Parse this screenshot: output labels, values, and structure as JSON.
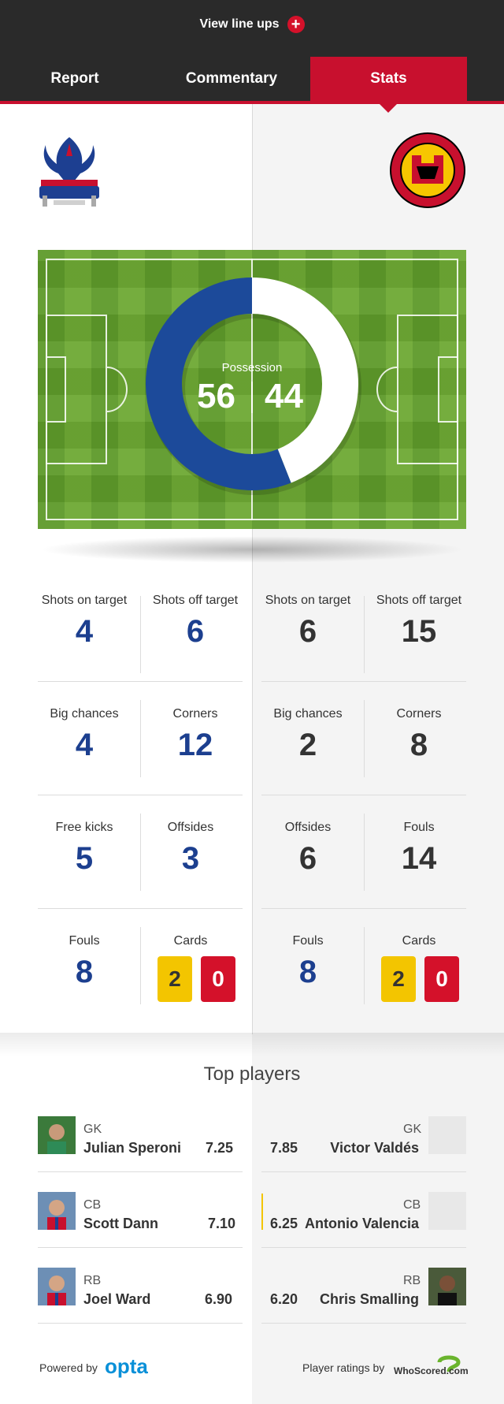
{
  "header": {
    "lineups_label": "View line ups",
    "plus_icon": "+"
  },
  "tabs": [
    {
      "label": "Report"
    },
    {
      "label": "Commentary"
    },
    {
      "label": "Stats",
      "active": true
    }
  ],
  "teams": {
    "home": {
      "crest": "Crystal Palace F.C."
    },
    "away": {
      "crest": "Manchester United"
    }
  },
  "possession": {
    "label": "Possession",
    "home": 56,
    "away": 44,
    "home_color": "#1c4a9a",
    "away_color": "#ffffff"
  },
  "stats": {
    "home": [
      {
        "label": "Shots on target",
        "value": "4"
      },
      {
        "label": "Shots off target",
        "value": "6"
      },
      {
        "label": "Big chances",
        "value": "4"
      },
      {
        "label": "Corners",
        "value": "12"
      },
      {
        "label": "Free kicks",
        "value": "5"
      },
      {
        "label": "Offsides",
        "value": "3"
      },
      {
        "label": "Fouls",
        "value": "8"
      },
      {
        "label": "Cards",
        "yellow": "2",
        "red": "0"
      }
    ],
    "away": [
      {
        "label": "Shots on target",
        "value": "6"
      },
      {
        "label": "Shots off target",
        "value": "15"
      },
      {
        "label": "Big chances",
        "value": "2"
      },
      {
        "label": "Corners",
        "value": "8"
      },
      {
        "label": "Offsides",
        "value": "6"
      },
      {
        "label": "Fouls",
        "value": "14"
      },
      {
        "label": "Fouls",
        "value": "8"
      },
      {
        "label": "Cards",
        "yellow": "2",
        "red": "0"
      }
    ]
  },
  "top_players": {
    "title": "Top players",
    "home": [
      {
        "pos": "GK",
        "name": "Julian Speroni",
        "rating": "7.25"
      },
      {
        "pos": "CB",
        "name": "Scott Dann",
        "rating": "7.10"
      },
      {
        "pos": "RB",
        "name": "Joel Ward",
        "rating": "6.90"
      }
    ],
    "away": [
      {
        "pos": "GK",
        "name": "Victor Valdés",
        "rating": "7.85"
      },
      {
        "pos": "CB",
        "name": "Antonio Valencia",
        "rating": "6.25"
      },
      {
        "pos": "RB",
        "name": "Chris Smalling",
        "rating": "6.20"
      }
    ]
  },
  "footer": {
    "powered_by": "Powered by",
    "opta": "opta",
    "ratings_by": "Player ratings by",
    "whoscored": "WhoScored.com"
  },
  "colors": {
    "brand_red": "#c8102e",
    "home_blue": "#1c3f8f",
    "header_dark": "#2a2a2a"
  }
}
